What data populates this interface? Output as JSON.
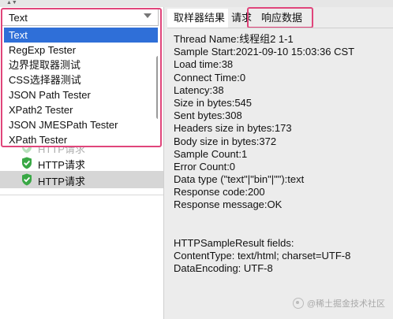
{
  "sampler_tree": {
    "rows": [
      {
        "label": "HTTP请求"
      },
      {
        "label": "HTTP请求"
      },
      {
        "label": "HTTP请求"
      }
    ]
  },
  "renderer_select": {
    "selected": "Text",
    "options": [
      "Text",
      "RegExp Tester",
      "边界提取器测试",
      "CSS选择器测试",
      "JSON Path Tester",
      "XPath2 Tester",
      "JSON JMESPath Tester",
      "XPath Tester"
    ]
  },
  "tabs": [
    {
      "label": "取样器结果"
    },
    {
      "label": "请求"
    },
    {
      "label": "响应数据"
    }
  ],
  "result_lines": [
    "Thread Name:线程组2 1-1",
    "Sample Start:2021-09-10 15:03:36 CST",
    "Load time:38",
    "Connect Time:0",
    "Latency:38",
    "Size in bytes:545",
    "Sent bytes:308",
    "Headers size in bytes:173",
    "Body size in bytes:372",
    "Sample Count:1",
    "Error Count:0",
    "Data type (\"text\"|\"bin\"|\"\"):text",
    "Response code:200",
    "Response message:OK",
    "",
    "",
    "HTTPSampleResult fields:",
    "ContentType: text/html; charset=UTF-8",
    "DataEncoding: UTF-8"
  ],
  "watermark": "@稀土掘金技术社区",
  "colors": {
    "highlight": "#e0457b",
    "selection": "#2f6fd8",
    "success": "#39a845"
  }
}
